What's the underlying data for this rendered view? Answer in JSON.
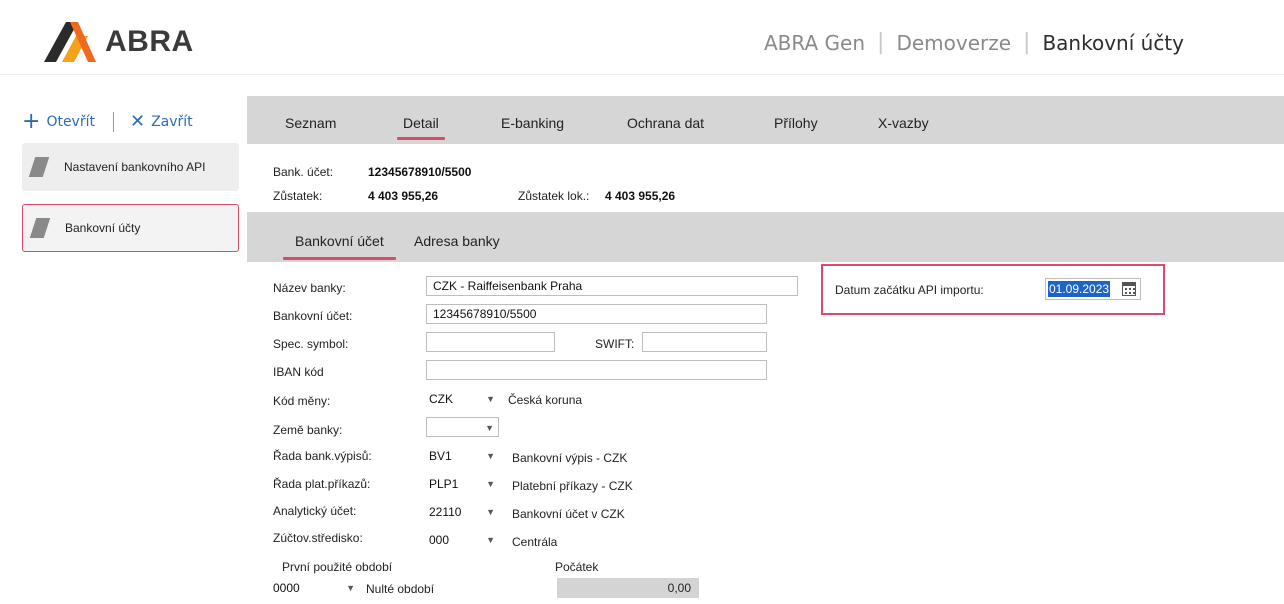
{
  "header": {
    "logo_text": "ABRA",
    "breadcrumb": [
      "ABRA Gen",
      "Demoverze",
      "Bankovní účty"
    ]
  },
  "nav": {
    "open_label": "Otevřít",
    "close_label": "Zavřít",
    "items": [
      {
        "label": "Nastavení bankovního API"
      },
      {
        "label": "Bankovní účty",
        "selected": true
      }
    ]
  },
  "tabs": [
    {
      "label": "Seznam"
    },
    {
      "label": "Detail",
      "active": true
    },
    {
      "label": "E-banking"
    },
    {
      "label": "Ochrana dat"
    },
    {
      "label": "Přílohy"
    },
    {
      "label": "X-vazby"
    }
  ],
  "summary": {
    "account_label": "Bank. účet:",
    "account_value": "12345678910/5500",
    "balance_label": "Zůstatek:",
    "balance_value": "4 403 955,26",
    "local_balance_label": "Zůstatek lok.:",
    "local_balance_value": "4 403 955,26"
  },
  "subtabs": [
    {
      "label": "Bankovní účet",
      "active": true
    },
    {
      "label": "Adresa banky"
    }
  ],
  "form": {
    "bank_name_label": "Název banky:",
    "bank_name_value": "CZK - Raiffeisenbank Praha",
    "account_label": "Bankovní účet:",
    "account_value": "12345678910/5500",
    "spec_symbol_label": "Spec. symbol:",
    "spec_symbol_value": "",
    "swift_label": "SWIFT:",
    "swift_value": "",
    "iban_label": "IBAN kód",
    "iban_value": "",
    "currency_label": "Kód měny:",
    "currency_value": "CZK",
    "currency_desc": "Česká koruna",
    "country_label": "Země banky:",
    "country_value": "",
    "statement_series_label": "Řada bank.výpisů:",
    "statement_series_value": "BV1",
    "statement_series_desc": "Bankovní výpis - CZK",
    "payment_series_label": "Řada plat.příkazů:",
    "payment_series_value": "PLP1",
    "payment_series_desc": "Platební příkazy - CZK",
    "analytic_label": "Analytický účet:",
    "analytic_value": "22110",
    "analytic_desc": "Bankovní účet v CZK",
    "center_label": "Zúčtov.středisko:",
    "center_value": "000",
    "center_desc": "Centrála",
    "first_period_label": "První použité období",
    "first_period_value": "0000",
    "first_period_desc": "Nulté období",
    "start_label": "Počátek",
    "start_value": "0,00",
    "api_date_label": "Datum začátku API importu:",
    "api_date_value": "01.09.2023"
  },
  "colors": {
    "accent": "#d94a6c",
    "link": "#2b6cb8",
    "tabbar": "#d6d6d6",
    "selection": "#1e63c9"
  }
}
